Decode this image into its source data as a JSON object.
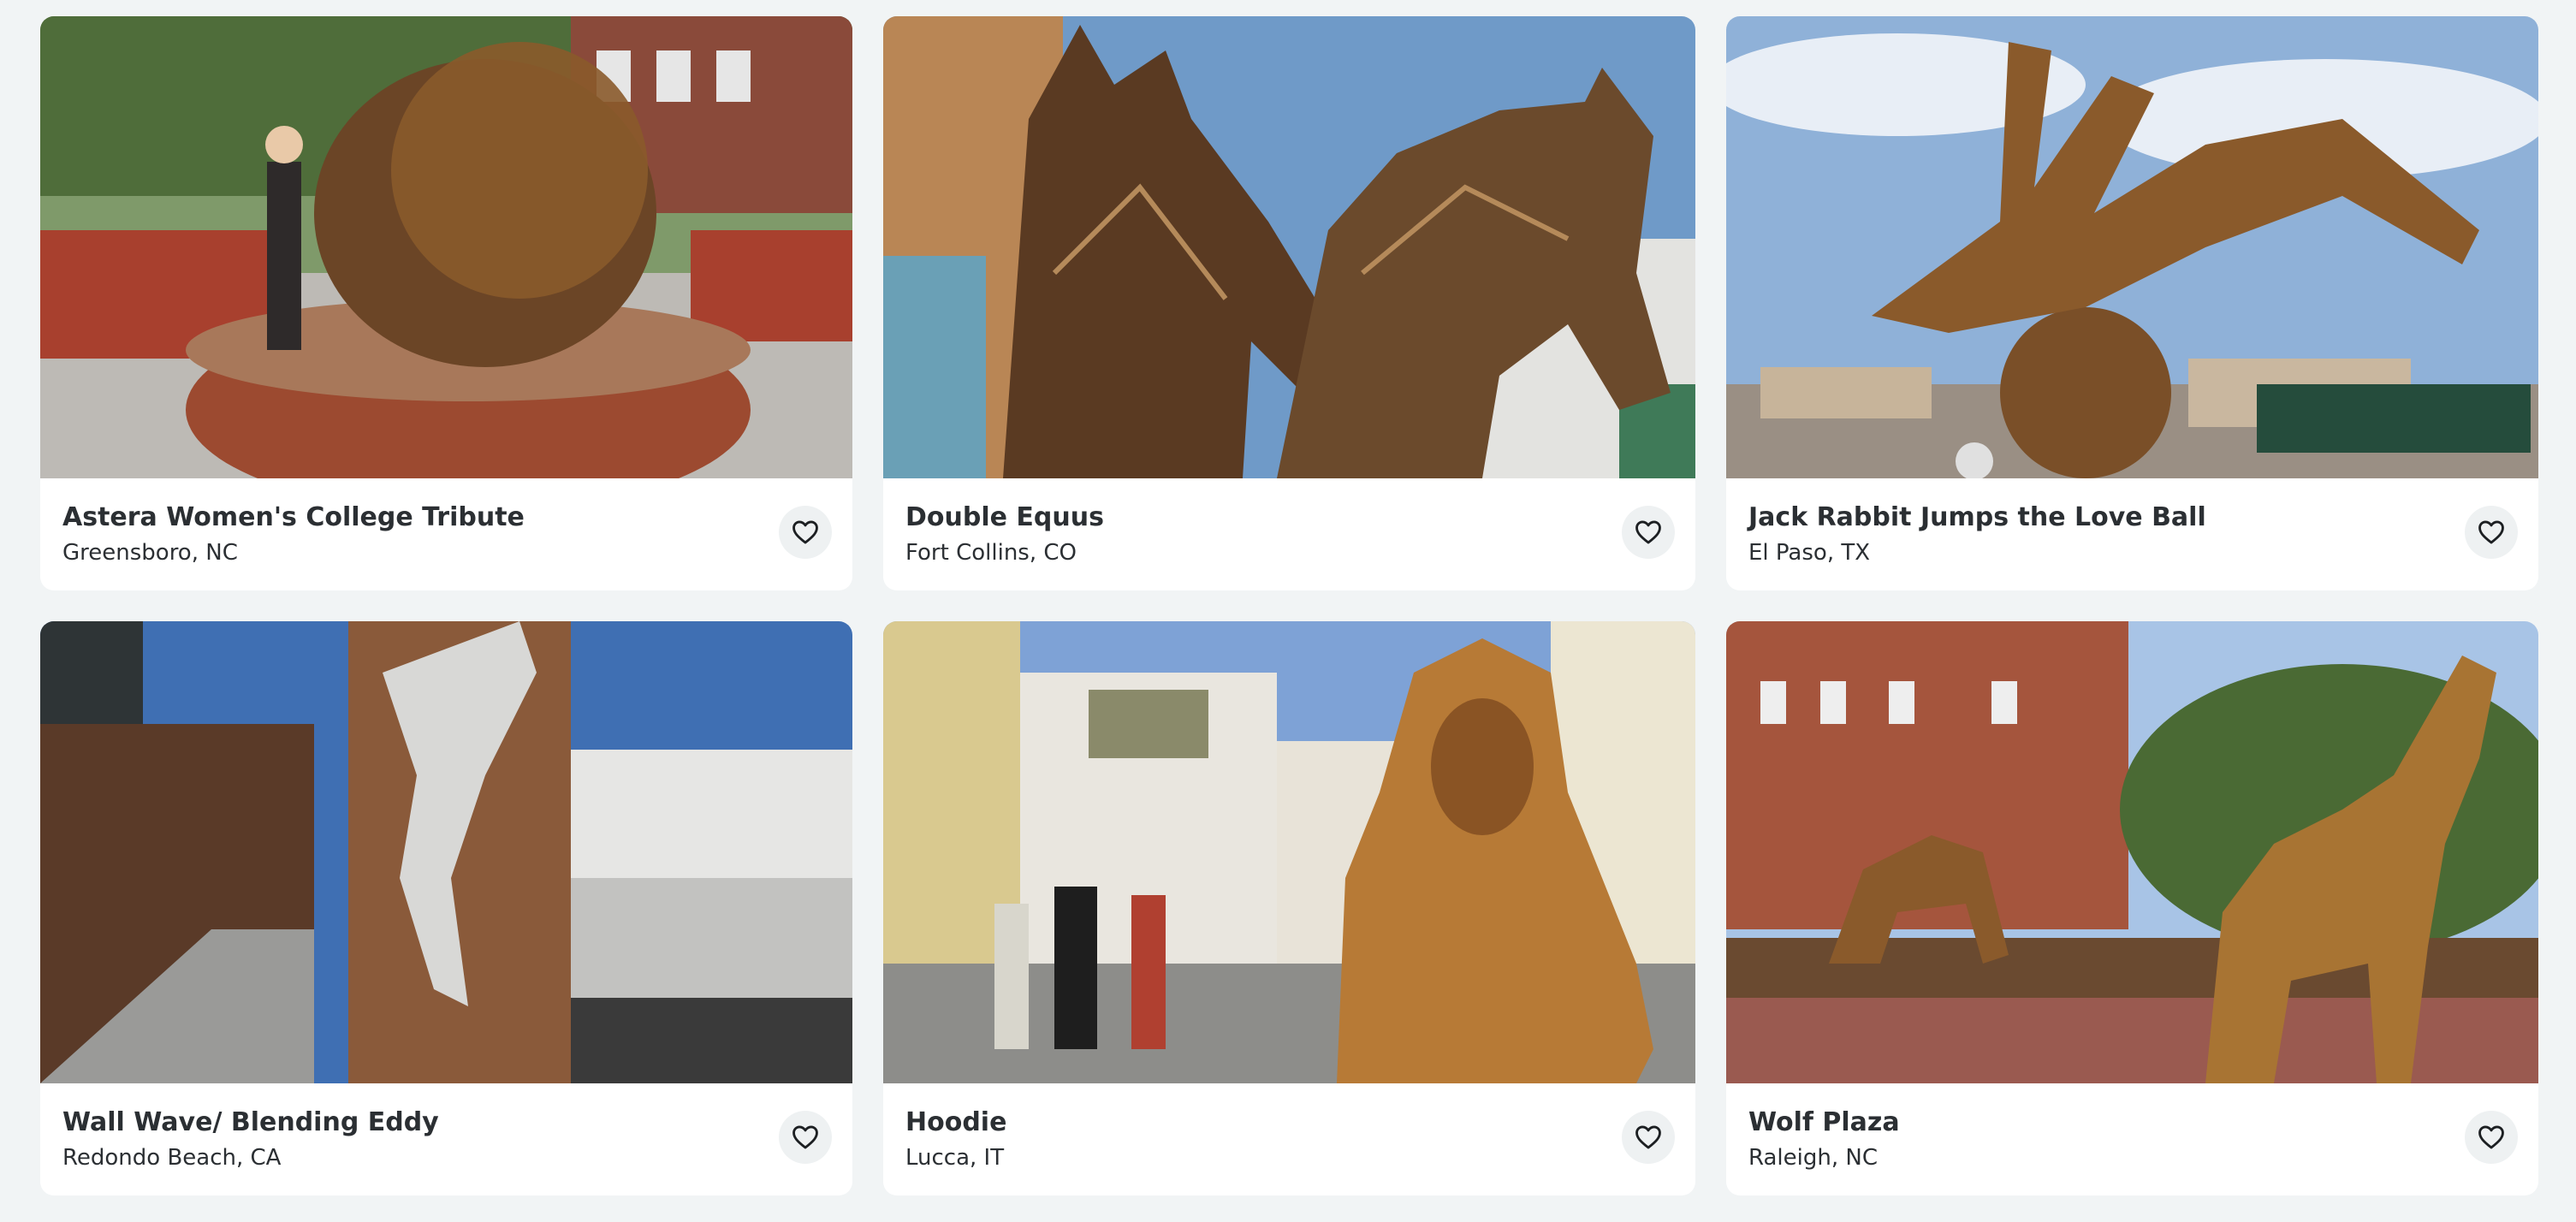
{
  "cards": [
    {
      "title": "Astera Women's College Tribute",
      "location": "Greensboro, NC",
      "image": "bronze-woman-head-sculpture-photo",
      "favorite_icon": "heart-icon"
    },
    {
      "title": "Double Equus",
      "location": "Fort Collins, CO",
      "image": "two-horse-head-sculpture-photo",
      "favorite_icon": "heart-icon"
    },
    {
      "title": "Jack Rabbit Jumps the Love Ball",
      "location": "El Paso, TX",
      "image": "jackrabbit-ball-sculpture-photo",
      "favorite_icon": "heart-icon"
    },
    {
      "title": "Wall Wave/ Blending Eddy",
      "location": "Redondo Beach, CA",
      "image": "wall-wave-sculpture-photo",
      "favorite_icon": "heart-icon"
    },
    {
      "title": "Hoodie",
      "location": "Lucca, IT",
      "image": "hooded-figure-sculpture-photo",
      "favorite_icon": "heart-icon"
    },
    {
      "title": "Wolf Plaza",
      "location": "Raleigh, NC",
      "image": "wolf-sculptures-photo",
      "favorite_icon": "heart-icon"
    }
  ],
  "colors": {
    "background": "#f1f4f5",
    "card": "#ffffff",
    "text": "#2b2f33",
    "bronze": "#8a5a2b"
  }
}
